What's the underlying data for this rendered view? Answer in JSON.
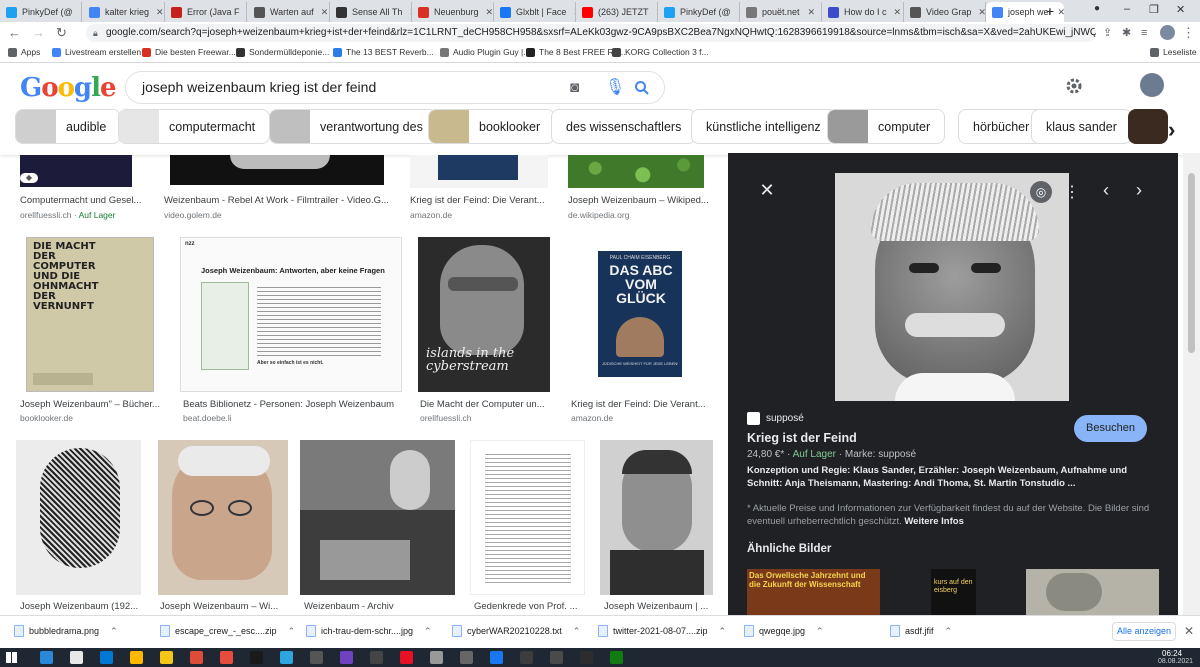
{
  "browser": {
    "tabs": [
      {
        "label": "PinkyDef (@",
        "icon": "twitter-icon",
        "color": "#1da1f2"
      },
      {
        "label": "kalter krieg",
        "icon": "google-icon",
        "color": "#4285f4"
      },
      {
        "label": "Error (Java F",
        "icon": "error-icon",
        "color": "#c5221f"
      },
      {
        "label": "Warten auf",
        "icon": "wikipedia-icon",
        "color": "#555555"
      },
      {
        "label": "Sense All Th",
        "icon": "sense-icon",
        "color": "#333333"
      },
      {
        "label": "Neuenburg",
        "icon": "z-icon",
        "color": "#d93025"
      },
      {
        "label": "Glxblt | Face",
        "icon": "facebook-icon",
        "color": "#1877f2"
      },
      {
        "label": "(263) JETZT",
        "icon": "youtube-icon",
        "color": "#ff0000"
      },
      {
        "label": "PinkyDef (@",
        "icon": "twitter-icon",
        "color": "#1da1f2"
      },
      {
        "label": "pouët.net",
        "icon": "pouet-icon",
        "color": "#777777"
      },
      {
        "label": "How do I c",
        "icon": "page-icon",
        "color": "#3c4ccc"
      },
      {
        "label": "Video Grap",
        "icon": "wikipedia-icon",
        "color": "#555555"
      },
      {
        "label": "joseph wei",
        "icon": "google-icon",
        "color": "#4285f4",
        "active": true
      }
    ],
    "new_tab": "+",
    "url": "google.com/search?q=joseph+weizenbaum+krieg+ist+der+feind&rlz=1C1LRNT_deCH958CH958&sxsrf=ALeKk03gwz-9CA9psBXC2Bea7NgxNQHwtQ:1628396619918&source=lnms&tbm=isch&sa=X&ved=2ahUKEwi_jNWQyqDyAhUvhv0HHfRGBiMQ_A...",
    "bookmarks": [
      {
        "label": "Apps",
        "color": "#5f6368"
      },
      {
        "label": "Livestream erstellen",
        "color": "#4285f4"
      },
      {
        "label": "Die besten Freewar...",
        "color": "#d93025"
      },
      {
        "label": "Sondermülldeponie...",
        "color": "#333333"
      },
      {
        "label": "The 13 BEST Reverb...",
        "color": "#2b7de9"
      },
      {
        "label": "Audio Plugin Guy |...",
        "color": "#777777"
      },
      {
        "label": "The 8 Best FREE Re...",
        "color": "#222222"
      },
      {
        "label": "KORG Collection 3 f...",
        "color": "#444444"
      }
    ],
    "reading_list": "Leseliste"
  },
  "google": {
    "logo": "Google",
    "query": "joseph weizenbaum krieg ist der feind",
    "chips": [
      "audible",
      "computermacht",
      "verantwortung des",
      "booklooker",
      "des wissenschaftlers",
      "künstliche intelligenz",
      "computer",
      "hörbücher",
      "klaus sander"
    ]
  },
  "results": [
    {
      "title": "Computermacht und Gesel...",
      "source": "orellfuessli.ch",
      "badge": "Auf Lager"
    },
    {
      "title": "Weizenbaum - Rebel At Work - Filmtrailer - Video.G...",
      "source": "video.golem.de"
    },
    {
      "title": "Krieg ist der Feind: Die Verant...",
      "source": "amazon.de"
    },
    {
      "title": "Joseph Weizenbaum – Wikiped...",
      "source": "de.wikipedia.org"
    },
    {
      "title": "Joseph Weizenbaum\" – Bücher...",
      "source": "booklooker.de",
      "cover_text": "DIE MACHT DER COMPUTER UND DIE OHNMACHT DER VERNUNFT"
    },
    {
      "title": "Beats Biblionetz - Personen: Joseph Weizenbaum",
      "source": "beat.doebe.li",
      "doc_heading": "Joseph Weizenbaum: Antworten, aber keine Fragen",
      "doc_footer": "Aber so einfach ist es nicht."
    },
    {
      "title": "Die Macht der Computer un...",
      "source": "orellfuessli.ch",
      "cover_text": "islands in the cyberstream"
    },
    {
      "title": "Krieg ist der Feind: Die Verant...",
      "source": "amazon.de",
      "cover_author": "PAUL CHAIM EISENBERG",
      "cover_text": "DAS ABC VOM GLÜCK",
      "cover_sub": "JÜDISCHE WEISHEIT FÜR JEDE LEBENSLAGE"
    },
    {
      "title": "Joseph Weizenbaum (192...",
      "source": ""
    },
    {
      "title": "Joseph Weizenbaum – Wi...",
      "source": ""
    },
    {
      "title": "Weizenbaum - Archiv",
      "source": ""
    },
    {
      "title": "Gedenkrede von Prof. ...",
      "source": ""
    },
    {
      "title": "Joseph Weizenbaum | ...",
      "source": ""
    }
  ],
  "preview": {
    "site": "supposé",
    "title": "Krieg ist der Feind",
    "visit_label": "Besuchen",
    "price": "24,80 €*",
    "stock": "Auf Lager",
    "brand": "Marke: supposé",
    "description": "Konzeption und Regie: Klaus Sander, Erzähler: Joseph Weizenbaum, Aufnahme und Schnitt: Anja Theismann, Mastering: Andi Thoma, St. Martin Tonstudio ...",
    "disclaimer": "* Aktuelle Preise und Informationen zur Verfügbarkeit findest du auf der Website. Die Bilder sind eventuell urheberrechtlich geschützt.",
    "more_info": "Weitere Infos",
    "similar_heading": "Ähnliche Bilder",
    "similar_texts": [
      "Das Orwellsche Jahrzehnt und die Zukunft der Wissenschaft",
      "kurs auf den eisberg"
    ]
  },
  "downloads": {
    "items": [
      "bubbledrama.png",
      "escape_crew_-_esc....zip",
      "ich-trau-dem-schr....jpg",
      "cyberWAR20210228.txt",
      "twitter-2021-08-07....zip",
      "qwegqe.jpg",
      "asdf.jfif"
    ],
    "show_all": "Alle anzeigen"
  },
  "taskbar": {
    "time": "06:24",
    "date": "08.08.2021"
  }
}
